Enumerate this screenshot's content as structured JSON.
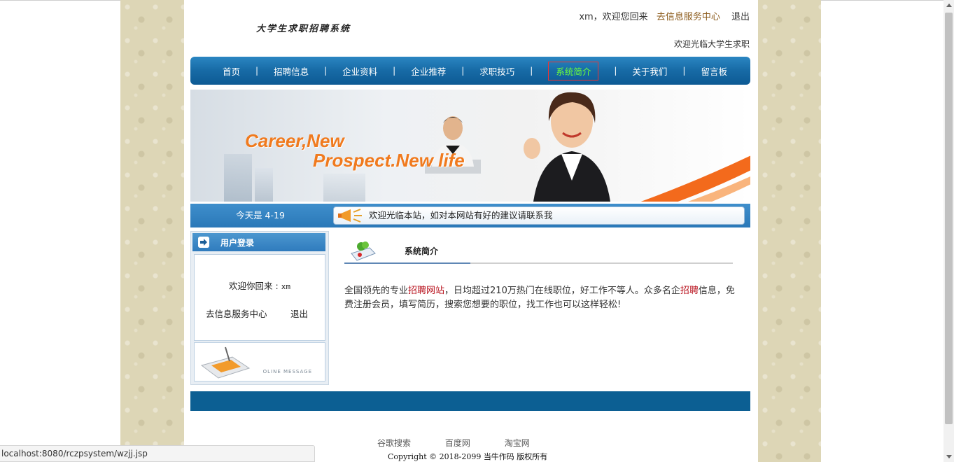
{
  "header": {
    "logo_text": "大学生求职招聘系统",
    "user_greeting": "xm，欢迎您回来",
    "service_center_link": "去信息服务中心",
    "logout_link": "退出",
    "scroll_text": "欢迎光临大学生求职"
  },
  "nav": {
    "items": [
      {
        "label": "首页"
      },
      {
        "label": "招聘信息"
      },
      {
        "label": "企业资料"
      },
      {
        "label": "企业推荐"
      },
      {
        "label": "求职技巧"
      },
      {
        "label": "系统简介"
      },
      {
        "label": "关于我们"
      },
      {
        "label": "留言板"
      }
    ],
    "separator": "|",
    "active_index": 5
  },
  "banner": {
    "line1": "Career,New",
    "line2": "Prospect.New life"
  },
  "infobar": {
    "date_text": "今天是 4-19",
    "notice_text": "欢迎光临本站，如对本网站有好的建议请联系我"
  },
  "sidebar": {
    "title": "用户登录",
    "welcome_label": "欢迎你回来 : ",
    "username": "xm",
    "service_link": "去信息服务中心",
    "logout_link": "退出",
    "message_caption": "OLINE MESSAGE"
  },
  "content": {
    "section_title": "系统简介",
    "intro_part1": "全国领先的专业",
    "intro_hl1": "招聘网站",
    "intro_part2": "，日均超过210万热门在线职位，好工作不等人。众多名企",
    "intro_hl2": "招聘",
    "intro_part3": "信息，免费注册会员，填写简历，搜索您想要的职位，找工作也可以这样轻松!"
  },
  "footer": {
    "links": [
      "谷歌搜索",
      "百度网",
      "淘宝网"
    ],
    "copyright": "Copyright © 2018-2099 当牛作码 版权所有"
  },
  "browser": {
    "status_url": "localhost:8080/rczpsystem/wzjj.jsp"
  },
  "colors": {
    "nav_blue": "#176aa5",
    "active_nav_text": "#6dff3a",
    "highlight_red": "#b8121d",
    "footer_blue": "#0c5f93"
  }
}
